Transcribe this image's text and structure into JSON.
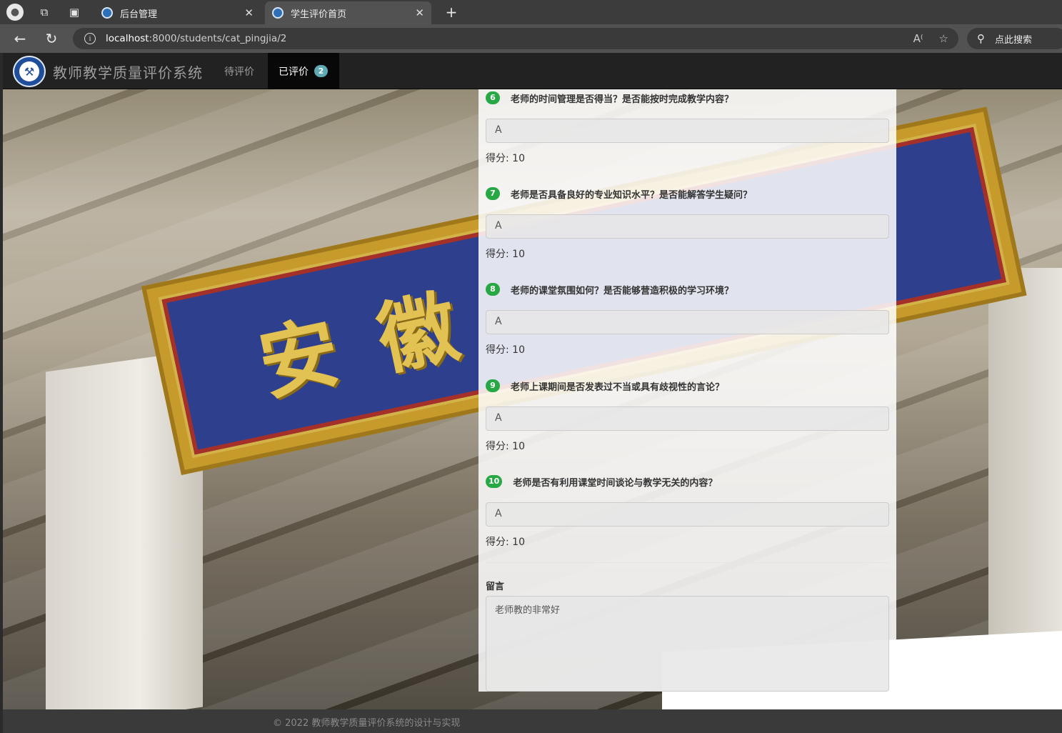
{
  "browser": {
    "tabs": [
      {
        "label": "后台管理",
        "active": false
      },
      {
        "label": "学生评价首页",
        "active": true
      }
    ],
    "url_host": "localhost",
    "url_path": ":8000/students/cat_pingjia/2",
    "search_label": "点此搜索"
  },
  "site": {
    "brand": "教师教学质量评价系统",
    "nav": {
      "pending_label": "待评价",
      "done_label": "已评价",
      "done_count": "2"
    }
  },
  "questions": [
    {
      "number": "6",
      "text": "老师的时间管理是否得当？是否能按时完成教学内容？",
      "answer": "A",
      "score": "得分: 10"
    },
    {
      "number": "7",
      "text": "老师是否具备良好的专业知识水平？是否能解答学生疑问？",
      "answer": "A",
      "score": "得分: 10"
    },
    {
      "number": "8",
      "text": "老师的课堂氛围如何？是否能够营造积极的学习环境？",
      "answer": "A",
      "score": "得分: 10"
    },
    {
      "number": "9",
      "text": "老师上课期间是否发表过不当或具有歧视性的言论？",
      "answer": "A",
      "score": "得分: 10"
    },
    {
      "number": "10",
      "text": "老师是否有利用课堂时间谈论与教学无关的内容？",
      "answer": "A",
      "score": "得分: 10"
    }
  ],
  "comment": {
    "label": "留言",
    "value": "老师教的非常好"
  },
  "background_sign": [
    "安",
    "徽"
  ],
  "footer": {
    "text": "© 2022 教师教学质量评价系统的设计与实现"
  },
  "colors": {
    "navbar": "#222222",
    "badge": "#5fa9b5",
    "question_number": "#27a844"
  }
}
